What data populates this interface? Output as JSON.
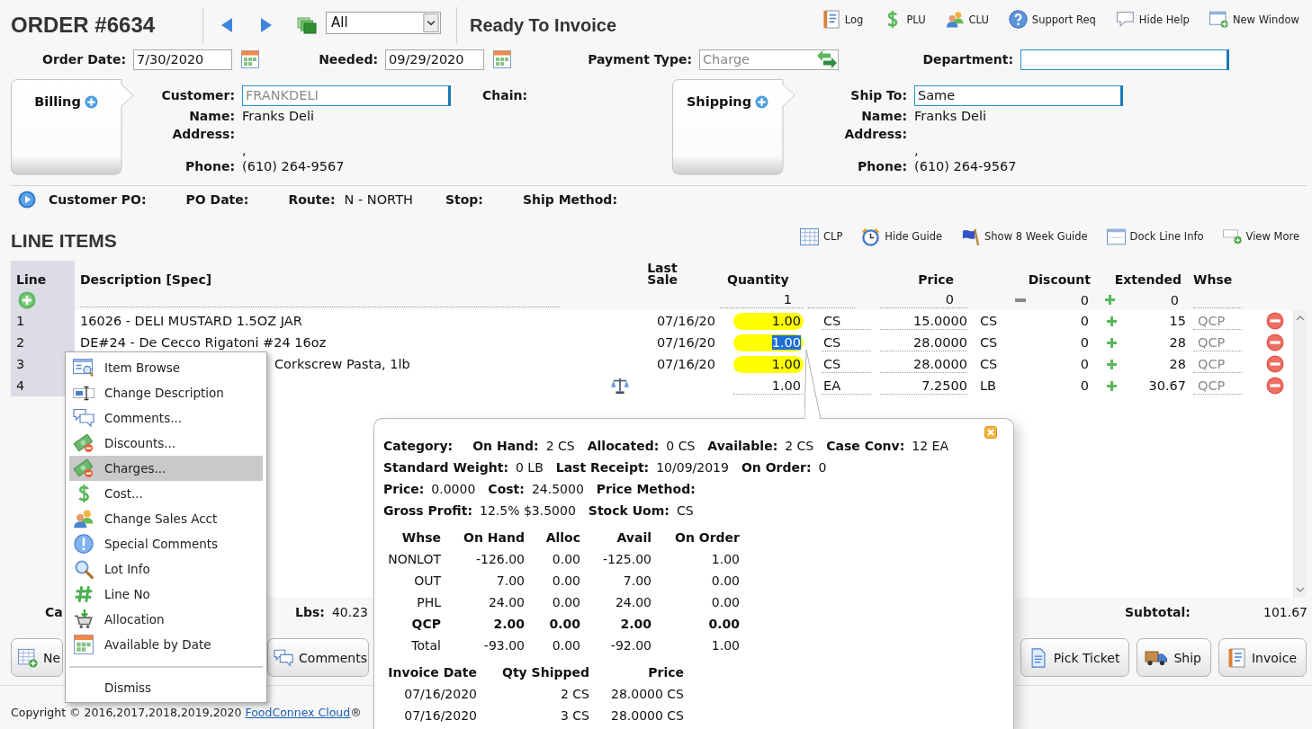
{
  "header": {
    "title": "ORDER #6634",
    "filter": "All",
    "status": "Ready To Invoice"
  },
  "top_links": [
    "Log",
    "PLU",
    "CLU",
    "Support Req",
    "Hide Help",
    "New Window"
  ],
  "order_fields": [
    {
      "label": "Order Date:",
      "value": "7/30/2020",
      "kind": "date",
      "disabled": false
    },
    {
      "label": "Needed:",
      "value": "09/29/2020",
      "kind": "date",
      "disabled": false
    },
    {
      "label": "Payment Type:",
      "value": "Charge",
      "kind": "select",
      "disabled": true
    },
    {
      "label": "Department:",
      "kind": "lookup"
    }
  ],
  "billing": {
    "tab": "Billing",
    "fields": [
      {
        "label": "Customer:",
        "value": "FRANKDELI",
        "kind": "lookup",
        "disabled": true
      },
      {
        "label": "Name:",
        "value": "Franks Deli"
      },
      {
        "label": "Address:"
      },
      {
        "value": ","
      },
      {
        "label": "Phone:",
        "value": "(610) 264-9567"
      }
    ],
    "extra_label": "Chain:"
  },
  "shipping": {
    "tab": "Shipping",
    "fields": [
      {
        "label": "Ship To:",
        "value": "Same",
        "kind": "lookup",
        "disabled": false
      },
      {
        "label": "Name:",
        "value": "Franks Deli"
      },
      {
        "label": "Address:"
      },
      {
        "value": ","
      },
      {
        "label": "Phone:",
        "value": "(610) 264-9567"
      }
    ]
  },
  "order_info": [
    {
      "label": "Customer PO:"
    },
    {
      "label": "PO Date:"
    },
    {
      "label": "Route:",
      "value": "N - NORTH"
    },
    {
      "label": "Stop:"
    },
    {
      "label": "Ship Method:"
    }
  ],
  "line_items": {
    "title": "LINE ITEMS",
    "tools": [
      "CLP",
      "Hide Guide",
      "Show 8 Week Guide",
      "Dock Line Info",
      "View More"
    ],
    "columns": [
      "Line",
      "Description [Spec]",
      "Last Sale",
      "Quantity",
      "Price",
      "Discount",
      "Extended",
      "Whse"
    ],
    "entry": {
      "quantity": "1",
      "price": "0",
      "discount": "0",
      "extended": "0"
    },
    "rows": [
      {
        "line": "1",
        "description": "16026 - DELI MUSTARD 1.5OZ JAR",
        "description_covered": false,
        "weighed": false,
        "last_sale": "07/16/20",
        "quantity": "1.00",
        "qty_highlight": true,
        "qty_selected": false,
        "unit": "CS",
        "price": "15.0000",
        "price_unit": "CS",
        "discount": "0",
        "extended": "15",
        "whse": "QCP"
      },
      {
        "line": "2",
        "description": "DE#24 - De Cecco Rigatoni #24 16oz",
        "description_covered": false,
        "weighed": false,
        "last_sale": "07/16/20",
        "quantity": "1.00",
        "qty_highlight": true,
        "qty_selected": true,
        "unit": "CS",
        "price": "28.0000",
        "price_unit": "CS",
        "discount": "0",
        "extended": "28",
        "whse": "QCP"
      },
      {
        "line": "3",
        "description": "Corkscrew Pasta, 1lb",
        "description_covered": true,
        "weighed": false,
        "last_sale": "07/16/20",
        "quantity": "1.00",
        "qty_highlight": true,
        "qty_selected": false,
        "unit": "CS",
        "price": "28.0000",
        "price_unit": "CS",
        "discount": "0",
        "extended": "28",
        "whse": "QCP"
      },
      {
        "line": "4",
        "weighed": true,
        "quantity": "1.00",
        "qty_highlight": false,
        "qty_selected": false,
        "unit": "EA",
        "price": "7.2500",
        "price_unit": "LB",
        "discount": "0",
        "extended": "30.67",
        "whse": "QCP"
      }
    ]
  },
  "summary": [
    {
      "label": "Ca"
    },
    {
      "label": "Lbs:",
      "value": "40.23"
    },
    {
      "label": "Subtotal:",
      "value": "101.67"
    }
  ],
  "buttons": [
    "Ne",
    "Comments",
    "Pick Ticket",
    "Ship",
    "Invoice"
  ],
  "copyright": {
    "before": "Copyright © 2016,2017,2018,2019,2020 ",
    "link": "FoodConnex Cloud",
    "after": "®"
  },
  "context_menu": {
    "items": [
      {
        "label": "Item Browse",
        "selected": false
      },
      {
        "label": "Change Description",
        "selected": false
      },
      {
        "label": "Comments...",
        "selected": false
      },
      {
        "label": "Discounts...",
        "selected": false
      },
      {
        "label": "Charges...",
        "selected": true
      },
      {
        "label": "Cost...",
        "selected": false
      },
      {
        "label": "Change Sales Acct",
        "selected": false
      },
      {
        "label": "Special Comments",
        "selected": false
      },
      {
        "label": "Lot Info",
        "selected": false
      },
      {
        "label": "Line No",
        "selected": false
      },
      {
        "label": "Allocation",
        "selected": false
      },
      {
        "label": "Available by Date",
        "selected": false
      }
    ],
    "dismiss": "Dismiss"
  },
  "stock_popup": {
    "facts": [
      [
        {
          "label": "Category:"
        },
        {
          "label": "On Hand:",
          "value": "2 CS"
        },
        {
          "label": "Allocated:",
          "value": "0 CS"
        },
        {
          "label": "Available:",
          "value": "2 CS"
        },
        {
          "label": "Case Conv:",
          "value": "12 EA"
        }
      ],
      [
        {
          "label": "Standard Weight:",
          "value": "0 LB"
        },
        {
          "label": "Last Receipt:",
          "value": "10/09/2019"
        },
        {
          "label": "On Order:",
          "value": "0"
        }
      ],
      [
        {
          "label": "Price:",
          "value": "0.0000"
        },
        {
          "label": "Cost:",
          "value": "24.5000"
        },
        {
          "label": "Price Method:"
        }
      ],
      [
        {
          "label": "Gross Profit:",
          "value": "12.5% $3.5000"
        },
        {
          "label": "Stock Uom:",
          "value": "CS"
        }
      ]
    ],
    "warehouses": {
      "columns": [
        "Whse",
        "On Hand",
        "Alloc",
        "Avail",
        "On Order"
      ],
      "rows": [
        {
          "cells": [
            "NONLOT",
            "-126.00",
            "0.00",
            "-125.00",
            "1.00"
          ],
          "current": false
        },
        {
          "cells": [
            "OUT",
            "7.00",
            "0.00",
            "7.00",
            "0.00"
          ],
          "current": false
        },
        {
          "cells": [
            "PHL",
            "24.00",
            "0.00",
            "24.00",
            "0.00"
          ],
          "current": false
        },
        {
          "cells": [
            "QCP",
            "2.00",
            "0.00",
            "2.00",
            "0.00"
          ],
          "current": true
        },
        {
          "cells": [
            "Total",
            "-93.00",
            "0.00",
            "-92.00",
            "1.00"
          ],
          "current": false
        }
      ]
    },
    "history": {
      "columns": [
        "Invoice Date",
        "Qty Shipped",
        "Price"
      ],
      "rows": [
        [
          "07/16/2020",
          "2 CS",
          "28.0000 CS"
        ],
        [
          "07/16/2020",
          "3 CS",
          "28.0000 CS"
        ]
      ]
    }
  }
}
